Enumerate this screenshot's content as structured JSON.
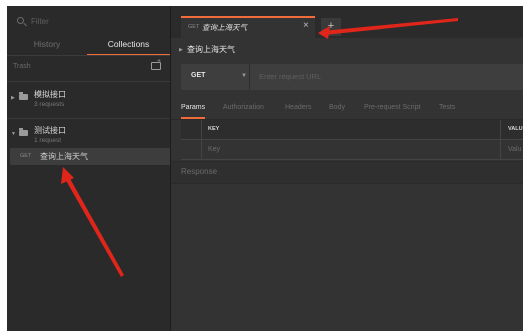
{
  "sidebar": {
    "filter_placeholder": "Filter",
    "tabs": [
      "History",
      "Collections"
    ],
    "active_tab": "Collections",
    "trash_label": "Trash",
    "collections": [
      {
        "name": "模拟接口",
        "count": "3 requests",
        "expanded": false
      },
      {
        "name": "测试接口",
        "count": "1 request",
        "expanded": true
      }
    ],
    "selected_request": {
      "method": "GET",
      "name": "查询上海天气"
    }
  },
  "tab": {
    "method": "GET",
    "title": "查询上海天气",
    "close": "×"
  },
  "add_tab": "+",
  "request": {
    "name": "查询上海天气",
    "method": "GET",
    "url_placeholder": "Enter request URL",
    "tabs": [
      "Params",
      "Authorization",
      "Headers",
      "Body",
      "Pre-request Script",
      "Tests"
    ],
    "active_tab": "Params"
  },
  "params_table": {
    "headers": [
      "KEY",
      "VALU"
    ],
    "row_placeholders": [
      "Key",
      "Valu"
    ]
  },
  "response_label": "Response",
  "colors": {
    "accent": "#f26b3a",
    "annotation": "#e0261a"
  }
}
